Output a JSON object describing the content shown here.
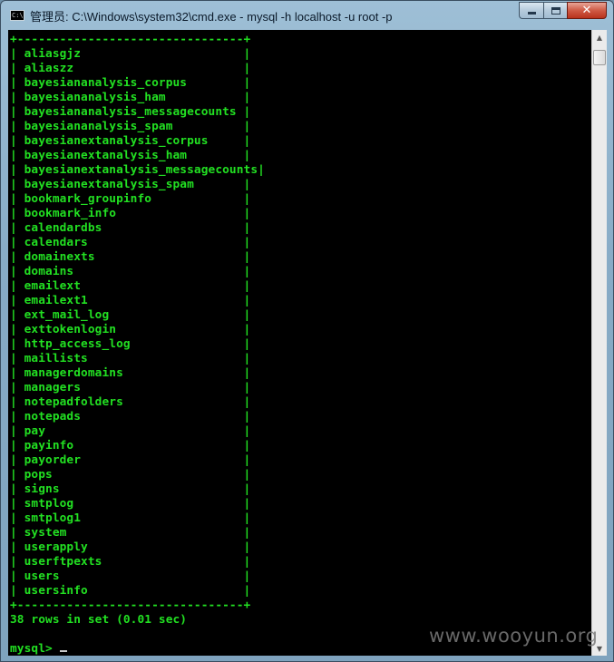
{
  "window": {
    "title": "管理员: C:\\Windows\\system32\\cmd.exe - mysql  -h localhost -u root -p",
    "icon": "cmd-icon",
    "icon_text": "C:\\"
  },
  "console": {
    "border": "+--------------------------------+",
    "rows": [
      "aliasgjz",
      "aliaszz",
      "bayesiananalysis_corpus",
      "bayesiananalysis_ham",
      "bayesiananalysis_messagecounts",
      "bayesiananalysis_spam",
      "bayesianextanalysis_corpus",
      "bayesianextanalysis_ham",
      "bayesianextanalysis_messagecounts",
      "bayesianextanalysis_spam",
      "bookmark_groupinfo",
      "bookmark_info",
      "calendardbs",
      "calendars",
      "domainexts",
      "domains",
      "emailext",
      "emailext1",
      "ext_mail_log",
      "exttokenlogin",
      "http_access_log",
      "maillists",
      "managerdomains",
      "managers",
      "notepadfolders",
      "notepads",
      "pay",
      "payinfo",
      "payorder",
      "pops",
      "signs",
      "smtplog",
      "smtplog1",
      "system",
      "userapply",
      "userftpexts",
      "users",
      "usersinfo"
    ],
    "summary": "38 rows in set (0.01 sec)",
    "prompt": "mysql> "
  },
  "watermark": "www.wooyun.org",
  "colors": {
    "console_bg": "#000000",
    "console_text": "#22e022",
    "close_button": "#c8432d"
  }
}
